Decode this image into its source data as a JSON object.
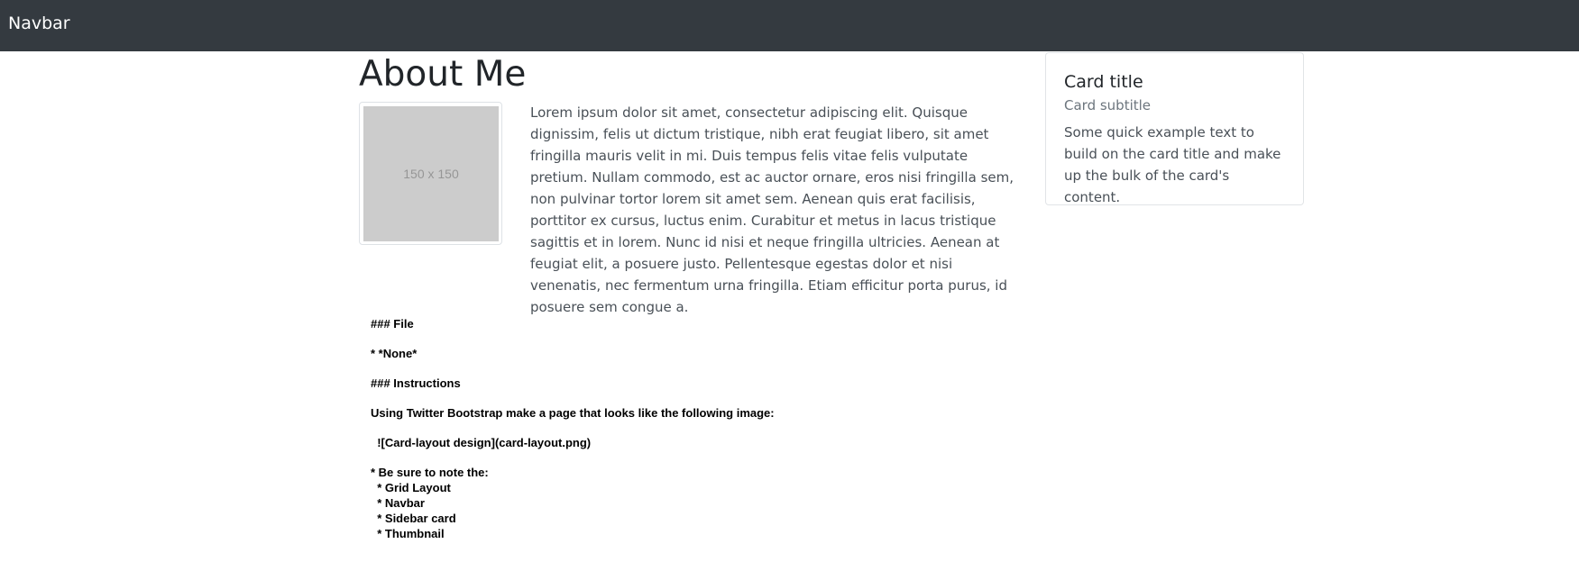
{
  "navbar": {
    "brand": "Navbar"
  },
  "main": {
    "title": "About Me",
    "thumbnail": {
      "label": "150 x 150"
    },
    "paragraph": "Lorem ipsum dolor sit amet, consectetur adipiscing elit. Quisque dignissim, felis ut dictum tristique, nibh erat feugiat libero, sit amet fringilla mauris velit in mi. Duis tempus felis vitae felis vulputate pretium. Nullam commodo, est ac auctor ornare, eros nisi fringilla sem, non pulvinar tortor lorem sit amet sem. Aenean quis erat facilisis, porttitor ex cursus, luctus enim. Curabitur et metus in lacus tristique sagittis et in lorem. Nunc id nisi et neque fringilla ultricies. Aenean at feugiat elit, a posuere justo. Pellentesque egestas dolor et nisi venenatis, nec fermentum urna fringilla. Etiam efficitur porta purus, id posuere sem congue a."
  },
  "sidebar_card": {
    "title": "Card title",
    "subtitle": "Card subtitle",
    "text": "Some quick example text to build on the card title and make up the bulk of the card's content."
  },
  "readme": {
    "file_heading": "### File",
    "file_item": "* *None*",
    "instructions_heading": "### Instructions",
    "instructions_text": "Using Twitter Bootstrap make a page that looks like the following image:",
    "image_markdown": "  ![Card-layout design](card-layout.png)",
    "note_heading": "* Be sure to note the:",
    "note_items": [
      "  * Grid Layout",
      "  * Navbar",
      "  * Sidebar card",
      "  * Thumbnail"
    ]
  }
}
